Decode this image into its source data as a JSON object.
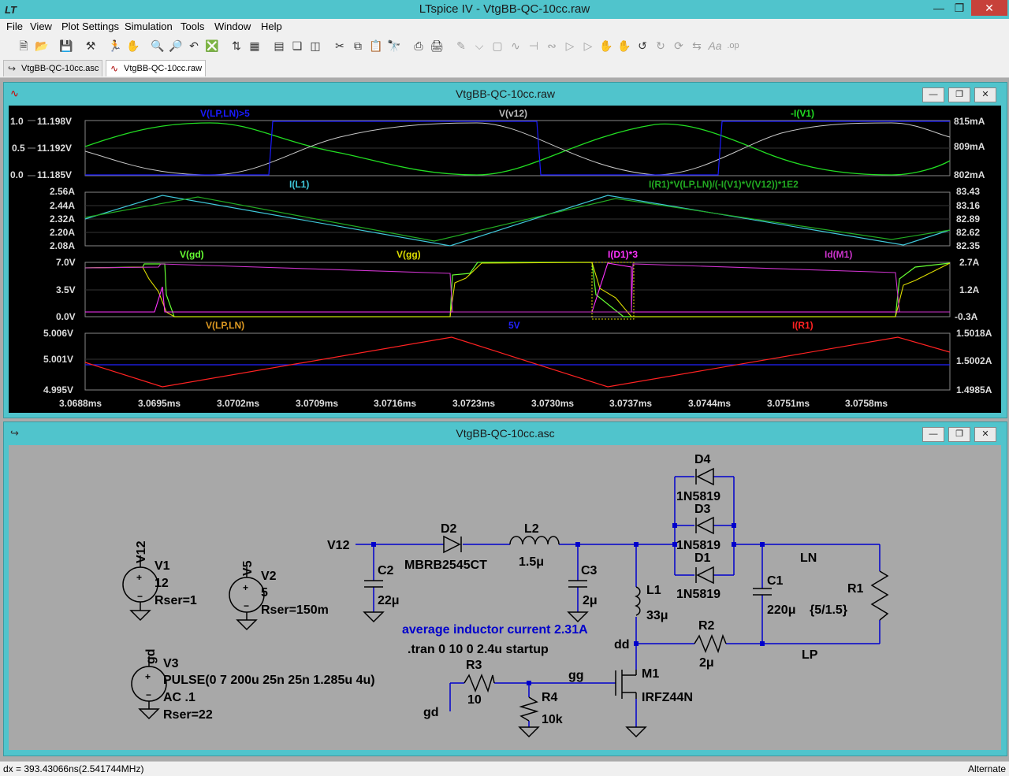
{
  "app": {
    "title": "LTspice IV - VtgBB-QC-10cc.raw"
  },
  "menu": [
    "File",
    "View",
    "Plot Settings",
    "Simulation",
    "Tools",
    "Window",
    "Help"
  ],
  "tabs": [
    {
      "label": "VtgBB-QC-10cc.asc",
      "active": false
    },
    {
      "label": "VtgBB-QC-10cc.raw",
      "active": true
    }
  ],
  "toolbar_icons": [
    "new-schematic-icon",
    "open-icon",
    "save-icon",
    "control-panel-icon",
    "run-icon",
    "halt-icon",
    "zoom-in-icon",
    "zoom-out-icon",
    "zoom-back-icon",
    "zoom-fit-icon",
    "autorange-icon",
    "grid-icon",
    "tile-horizontal-icon",
    "cascade-icon",
    "tile-vertical-icon",
    "cut-icon",
    "copy-icon",
    "paste-icon",
    "find-icon",
    "print-setup-icon",
    "print-icon",
    "wire-icon",
    "ground-icon",
    "label-icon",
    "resistor-icon",
    "capacitor-icon",
    "inductor-icon",
    "diode-icon",
    "component-icon",
    "move-icon",
    "drag-icon",
    "undo-icon",
    "redo-icon",
    "rotate-icon",
    "mirror-icon",
    "text-icon",
    "spice-directive-icon"
  ],
  "waveform_window": {
    "title": "VtgBB-QC-10cc.raw",
    "panes": [
      {
        "traces": [
          {
            "name": "V(LP,LN)>5",
            "color": "#1a1aff"
          },
          {
            "name": "V(v12)",
            "color": "#bdbdbd"
          },
          {
            "name": "-I(V1)",
            "color": "#22dd22"
          }
        ],
        "left_ticks": [
          "1.0",
          "0.5",
          "0.0"
        ],
        "left2_ticks": [
          "11.198V",
          "11.192V",
          "11.185V"
        ],
        "right_ticks": [
          "815mA",
          "809mA",
          "802mA"
        ]
      },
      {
        "traces": [
          {
            "name": "I(L1)",
            "color": "#3fc7d9"
          },
          {
            "name": "I(R1)*V(LP,LN)/(-I(V1)*V(V12))*1E2",
            "color": "#22aa22"
          }
        ],
        "left_ticks": [
          "2.56A",
          "2.44A",
          "2.32A",
          "2.20A",
          "2.08A"
        ],
        "right_ticks": [
          "83.43",
          "83.16",
          "82.89",
          "82.62",
          "82.35"
        ]
      },
      {
        "traces": [
          {
            "name": "V(gd)",
            "color": "#66ff33"
          },
          {
            "name": "V(gg)",
            "color": "#dddd00"
          },
          {
            "name": "I(D1)*3",
            "color": "#ff33ff"
          },
          {
            "name": "Id(M1)",
            "color": "#cc33cc"
          }
        ],
        "left_ticks": [
          "7.0V",
          "3.5V",
          "0.0V"
        ],
        "right_ticks": [
          "2.7A",
          "1.2A",
          "-0.3A"
        ]
      },
      {
        "traces": [
          {
            "name": "V(LP,LN)",
            "color": "#dd9922"
          },
          {
            "name": "5V",
            "color": "#2222ff"
          },
          {
            "name": "I(R1)",
            "color": "#ff2222"
          }
        ],
        "left_ticks": [
          "5.006V",
          "5.001V",
          "4.995V"
        ],
        "right_ticks": [
          "1.5018A",
          "1.5002A",
          "1.4985A"
        ]
      }
    ],
    "x_ticks": [
      "3.0688ms",
      "3.0695ms",
      "3.0702ms",
      "3.0709ms",
      "3.0716ms",
      "3.0723ms",
      "3.0730ms",
      "3.0737ms",
      "3.0744ms",
      "3.0751ms",
      "3.0758ms"
    ]
  },
  "schematic_window": {
    "title": "VtgBB-QC-10cc.asc",
    "labels": {
      "v12_net": "V12",
      "v1_ref": "V12",
      "v1_name": "V1",
      "v1_value": "12",
      "v1_rser": "Rser=1",
      "v5_ref": "V5",
      "v2_name": "V2",
      "v2_value": "5",
      "v2_rser": "Rser=150m",
      "gd_ref": "gd",
      "v3_name": "V3",
      "v3_value": "PULSE(0 7 200u 25n 25n 1.285u 4u)",
      "v3_ac": "AC .1",
      "v3_rser": "Rser=22",
      "c2_name": "C2",
      "c2_value": "22μ",
      "d2_name": "D2",
      "d2_value": "MBRB2545CT",
      "l2_name": "L2",
      "l2_value": "1.5μ",
      "c3_name": "C3",
      "c3_value": "2μ",
      "l1_name": "L1",
      "l1_value": "33μ",
      "d4_name": "D4",
      "d4_value": "1N5819",
      "d3_name": "D3",
      "d3_value": "1N5819",
      "d1_name": "D1",
      "d1_value": "1N5819",
      "c1_name": "C1",
      "c1_value": "220μ",
      "r1_name": "R1",
      "r1_value": "{5/1.5}",
      "ln": "LN",
      "lp": "LP",
      "r2_name": "R2",
      "r2_value": "2μ",
      "dd": "dd",
      "note": "average inductor current 2.31A",
      "directive": ".tran 0 10 0 2.4u startup",
      "r3_name": "R3",
      "r3_value": "10",
      "gg": "gg",
      "gd_net": "gd",
      "r4_name": "R4",
      "r4_value": "10k",
      "m1_name": "M1",
      "m1_value": "IRFZ44N"
    }
  },
  "status": {
    "left": "dx = 393.43066ns(2.541744MHz)",
    "right": "Alternate"
  }
}
